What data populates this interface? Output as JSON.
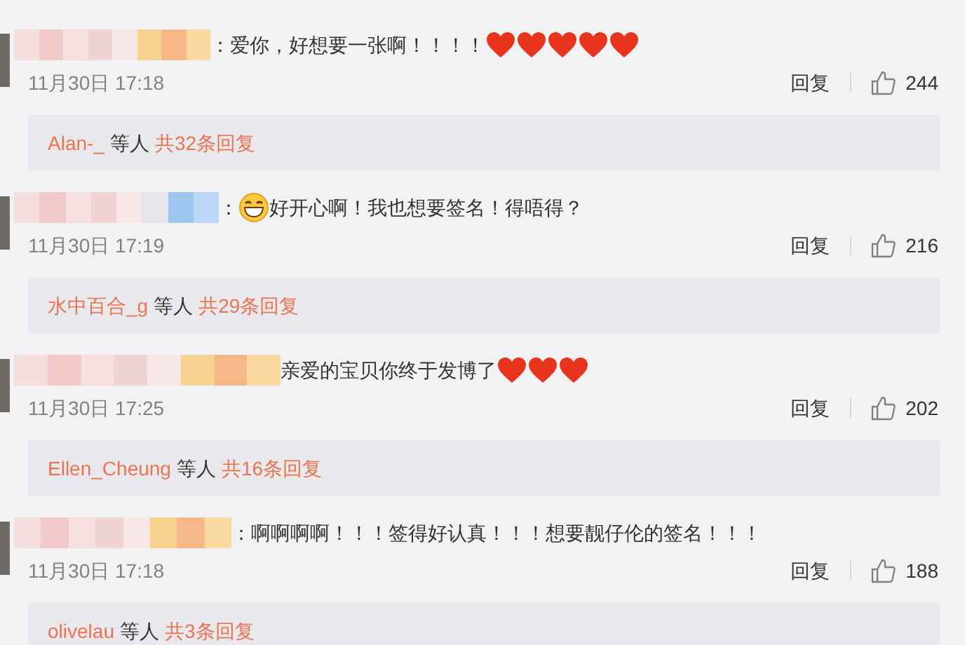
{
  "comments": [
    {
      "content": [
        {
          "kind": "text",
          "text": "：爱你，好想要一张啊！！！！"
        },
        {
          "kind": "heart"
        },
        {
          "kind": "heart"
        },
        {
          "kind": "heart"
        },
        {
          "kind": "heart"
        },
        {
          "kind": "heart"
        }
      ],
      "time": "11月30日 17:18",
      "reply_action": "回复",
      "likes": "244",
      "replies": {
        "users": "Alan-_",
        "etc": "等人",
        "total": "共32条回复"
      }
    },
    {
      "content": [
        {
          "kind": "text",
          "text": "："
        },
        {
          "kind": "grin"
        },
        {
          "kind": "text",
          "text": "好开心啊！我也想要签名！得唔得？"
        }
      ],
      "time": "11月30日 17:19",
      "reply_action": "回复",
      "likes": "216",
      "replies": {
        "users": "水中百合_g",
        "etc": "等人",
        "total": "共29条回复"
      }
    },
    {
      "content": [
        {
          "kind": "text",
          "text": "亲爱的宝贝你终于发博了"
        },
        {
          "kind": "heart"
        },
        {
          "kind": "heart"
        },
        {
          "kind": "heart"
        }
      ],
      "time": "11月30日 17:25",
      "reply_action": "回复",
      "likes": "202",
      "replies": {
        "users": "Ellen_Cheung",
        "etc": "等人",
        "total": "共16条回复"
      }
    },
    {
      "content": [
        {
          "kind": "text",
          "text": "：啊啊啊啊！！！签得好认真！！！想要靓仔伦的签名！！！"
        }
      ],
      "time": "11月30日 17:18",
      "reply_action": "回复",
      "likes": "188",
      "replies": {
        "users": "olivelau",
        "etc": "等人",
        "total": "共3条回复"
      }
    }
  ]
}
